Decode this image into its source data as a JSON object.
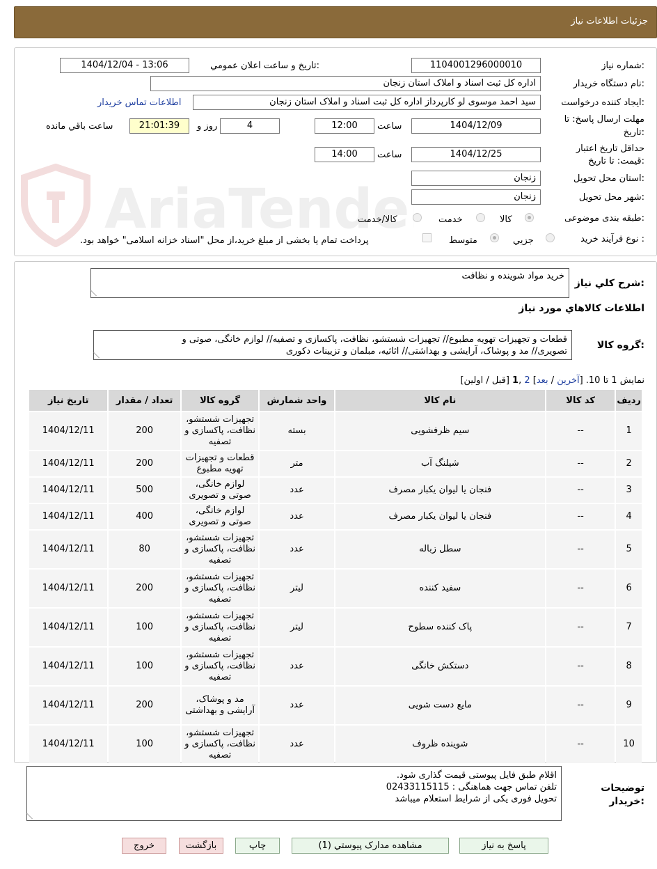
{
  "header": {
    "title": "جزئیات اطلاعات نیاز"
  },
  "info": {
    "need_number_label": "شماره نیاز:",
    "need_number": "1104001296000010",
    "announce_label": "تاریخ و ساعت اعلان عمومي:",
    "announce_value": "1404/12/04 - 13:06",
    "buyer_org_label": "نام دستگاه خریدار:",
    "buyer_org": "اداره کل ثبت اسناد و املاک استان زنجان",
    "requester_label": "ایجاد کننده درخواست:",
    "requester": "سید احمد موسوی لو کارپرداز اداره کل ثبت اسناد و املاک استان زنجان",
    "contact_link": "اطلاعات تماس خریدار",
    "deadline_label_1": "مهلت ارسال پاسخ: تا",
    "deadline_label_2": "تاریخ:",
    "deadline_date": "1404/12/09",
    "time_label": "ساعت",
    "deadline_time": "12:00",
    "days": "4",
    "days_label": "روز و",
    "remaining_time": "21:01:39",
    "remaining_label": "ساعت باقي مانده",
    "validity_label_1": "حداقل تاریخ اعتبار",
    "validity_label_2": "قیمت: تا تاریخ:",
    "validity_date": "1404/12/25",
    "validity_time": "14:00",
    "province_label": "استان محل تحویل:",
    "province": "زنجان",
    "city_label": "شهر محل تحویل:",
    "city": "زنجان",
    "category_label": "طبقه بندی موضوعی:",
    "category_options": [
      "کالا",
      "خدمت",
      "کالا/خدمت"
    ],
    "category_selected": "کالا",
    "process_label": "نوع فرآیند خرید :",
    "process_options": [
      "جزيي",
      "متوسط"
    ],
    "process_selected": "متوسط",
    "payment_note": "پرداخت تمام یا بخشی از مبلغ خرید،از محل \"اسناد خزانه اسلامی\" خواهد بود."
  },
  "watermark": {
    "text": "AriaTender.neT"
  },
  "need": {
    "summary_label": "شرح کلي نیاز:",
    "summary": "خرید مواد شوینده و نظافت",
    "goods_info_title": "اطلاعات کالاهاي مورد نیاز",
    "group_label": "گروه کالا:",
    "group_line1": "قطعات و تجهیزات تهویه مطبوع// تجهیزات شستشو، نظافت، پاکسازی و تصفیه// لوازم خانگی، صوتی و",
    "group_line2": "تصویری// مد و پوشاک، آرایشی و بهداشتی// اثاثیه، مبلمان و تزیینات دکوری",
    "pager_prefix": "نمایش 1 تا 10. [",
    "pager_last": "آخرین",
    "pager_sep1": " / ",
    "pager_next": "بعد",
    "pager_close1": "] ",
    "pager_page2": "2",
    "pager_comma": " ,",
    "pager_page1": "1",
    "pager_rest": " [قبل / اولین]"
  },
  "table": {
    "headers": [
      "ردیف",
      "کد کالا",
      "نام کالا",
      "واحد شمارش",
      "گروه کالا",
      "تعداد / مقدار",
      "تاریخ نیاز"
    ],
    "rows": [
      [
        "1",
        "--",
        "سیم ظرفشویی",
        "بسته",
        "تجهیزات شستشو، نظافت، پاکسازی و تصفیه",
        "200",
        "1404/12/11"
      ],
      [
        "2",
        "--",
        "شیلنگ آب",
        "متر",
        "قطعات و تجهیزات تهویه مطبوع",
        "200",
        "1404/12/11"
      ],
      [
        "3",
        "--",
        "فنجان یا لیوان یکبار مصرف",
        "عدد",
        "لوازم خانگی، صوتی و تصویری",
        "500",
        "1404/12/11"
      ],
      [
        "4",
        "--",
        "فنجان یا لیوان یکبار مصرف",
        "عدد",
        "لوازم خانگی، صوتی و تصویری",
        "400",
        "1404/12/11"
      ],
      [
        "5",
        "--",
        "سطل زباله",
        "عدد",
        "تجهیزات شستشو، نظافت، پاکسازی و تصفیه",
        "80",
        "1404/12/11"
      ],
      [
        "6",
        "--",
        "سفید کننده",
        "لیتر",
        "تجهیزات شستشو، نظافت، پاکسازی و تصفیه",
        "200",
        "1404/12/11"
      ],
      [
        "7",
        "--",
        "پاک کننده سطوح",
        "لیتر",
        "تجهیزات شستشو، نظافت، پاکسازی و تصفیه",
        "100",
        "1404/12/11"
      ],
      [
        "8",
        "--",
        "دستکش خانگی",
        "عدد",
        "تجهیزات شستشو، نظافت، پاکسازی و تصفیه",
        "100",
        "1404/12/11"
      ],
      [
        "9",
        "--",
        "مایع دست شویی",
        "عدد",
        "مد و پوشاک، آرایشی و بهداشتی",
        "200",
        "1404/12/11"
      ],
      [
        "10",
        "--",
        "شوینده ظروف",
        "عدد",
        "تجهیزات شستشو، نظافت، پاکسازی و تصفیه",
        "100",
        "1404/12/11"
      ]
    ]
  },
  "notes": {
    "label_1": "توضیحات",
    "label_2": "خریدار:",
    "line1": "اقلام طبق فایل پیوستی قیمت گذاری شود.",
    "line2": "تلفن تماس جهت هماهنگی : 02433115115",
    "line3": "تحویل فوری یکی از شرایط استعلام میباشد"
  },
  "buttons": {
    "reply": "پاسخ به نیاز",
    "attachments": "مشاهده مدارک پیوستي (1)",
    "print": "چاپ",
    "back": "بازگشت",
    "exit": "خروج"
  }
}
